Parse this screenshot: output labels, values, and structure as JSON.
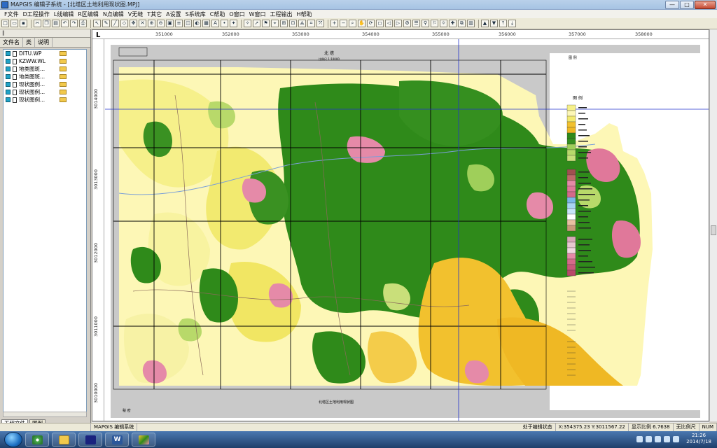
{
  "window": {
    "title": "MAPGIS 编辑子系统 - [北塔区土地利用现状图.MPJ]",
    "buttons": [
      "—",
      "□",
      "✕"
    ]
  },
  "menu": [
    "F文件",
    "D工程操作",
    "L线编辑",
    "R区编辑",
    "N点编辑",
    "V无缝",
    "T其它",
    "A设置",
    "S系统库",
    "C帮助",
    "O窗口",
    "W窗口",
    "工程输出",
    "H帮助"
  ],
  "left_panel": {
    "columns": [
      "文件名",
      "类",
      "说明"
    ],
    "items": [
      {
        "name": "DITU.WP",
        "kind": "check"
      },
      {
        "name": "KZWW.WL",
        "kind": "check"
      },
      {
        "name": "地类图斑...",
        "kind": "check"
      },
      {
        "name": "地类图斑...",
        "kind": "doc"
      },
      {
        "name": "现状图例...",
        "kind": "doc"
      },
      {
        "name": "现状图例...",
        "kind": "doc"
      },
      {
        "name": "现状图例...",
        "kind": "doc"
      }
    ],
    "tabs": [
      "工程文件",
      "图例"
    ]
  },
  "ruler": {
    "x_ticks": [
      "351000",
      "352000",
      "353000",
      "354000",
      "355000",
      "356000",
      "357000",
      "358000"
    ],
    "y_ticks": [
      "3014000",
      "3013000",
      "3012000",
      "3011000",
      "3010000"
    ]
  },
  "map": {
    "title": "北 塔",
    "subtitle": "比例尺 1:10000",
    "legend_title": "图 例",
    "legend_header": "图 例",
    "bottom_caption": "北塔区土地利用现状图",
    "left_caption": "秘 密"
  },
  "status": {
    "mode": "处于编辑状态",
    "coords": "X:354375.23 Y:3011567.22",
    "count": "显示比例 6.7638 ",
    "projection": "无比例尺",
    "num": "NUM"
  },
  "taskbar": {
    "app": "MAPGIS 编辑系统",
    "time": "21:26",
    "date": "2014/7/18"
  }
}
